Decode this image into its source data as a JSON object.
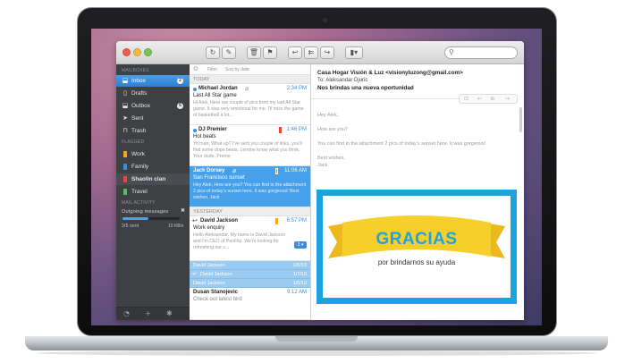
{
  "colors": {
    "accent": "#3b8ede",
    "sidebar": "#3e4044",
    "card_border": "#1da3e0",
    "banner": "#f7cf2b"
  },
  "toolbar": {
    "icons": [
      "refresh-icon",
      "compose-icon",
      "delete-icon",
      "flag-icon",
      "reply-icon",
      "reply-all-icon",
      "forward-icon",
      "move-icon"
    ],
    "search_placeholder": ""
  },
  "sidebar": {
    "mailboxes_header": "MAILBOXES",
    "inbox": {
      "label": "Inbox",
      "count": "2"
    },
    "drafts": {
      "label": "Drafts"
    },
    "outbox": {
      "label": "Outbox",
      "count": "6"
    },
    "sent": {
      "label": "Sent"
    },
    "trash": {
      "label": "Trash"
    },
    "flagged_header": "FLAGGED",
    "work": {
      "label": "Work",
      "color": "#f5a623"
    },
    "family": {
      "label": "Family",
      "color": "#3b8ede"
    },
    "shaolin": {
      "label": "Shaolin clan",
      "color": "#e8453c"
    },
    "travel": {
      "label": "Travel",
      "color": "#5cb85c"
    },
    "activity_header": "MAIL ACTIVITY",
    "outgoing_label": "Outgoing messages",
    "sent_status": "3/5 sent",
    "speed": "10 KB/s",
    "progress": 0.45
  },
  "list": {
    "filter": "Filter",
    "sort": "Sort by date",
    "today": "TODAY",
    "yesterday": "YESTERDAY",
    "messages": [
      {
        "from": "Michael Jordan",
        "time": "2:34 PM",
        "subject": "Last All Star game",
        "preview": "Hi Alek, Here are couple of pics from my last All Star game. It was very emotional for me. I'll miss the game of basketball a lot..."
      },
      {
        "from": "DJ Premier",
        "time": "1:46 PM",
        "subject": "Hot beats",
        "preview": "Yo man, What up? I've sent you couple of links, you'll find some dope beats. Lemme know what you think. Your dude, Premo"
      },
      {
        "from": "Jack Dorsey",
        "time": "11:06 AM",
        "subject": "San Francisco sunset",
        "preview": "Hey Alek, How are you? You can find in the attachment 2 pics of today's sunset here. It was gorgeous! Best wishes, Jack"
      },
      {
        "from": "David Jackson",
        "time": "6:57 PM",
        "subject": "Work enquiry",
        "preview": "Hello Aleksandar, My name is David Jackson and I'm CEO of PanFlip. We're looking for refreshing our c...",
        "count": "3"
      }
    ],
    "thread": [
      {
        "name": "David Jackson",
        "date": "1/5/13"
      },
      {
        "name": "David Jackson",
        "date": "1/7/13"
      },
      {
        "name": "David Jackson",
        "date": "1/6/13"
      }
    ],
    "last": {
      "from": "Dusan Stanojevic",
      "time": "9:12 AM",
      "subject": "Check out latest bird"
    }
  },
  "reader": {
    "from": "Casa Hogar Visión & Luz <visionyluzong@gmail.com>",
    "to": "To: Aleksandar Djuric",
    "subject": "Nos brindas una nueva oportunidad",
    "greeting": "Hey Alek,",
    "line1": "How are you?",
    "line2": "You can find in the attachment 2 pics of today's sunset here. It was gorgeous!",
    "signoff1": "Best wishes,",
    "signoff2": "Jack",
    "card_title": "GRACIAS",
    "card_tagline": "por brindarnos su ayuda"
  }
}
